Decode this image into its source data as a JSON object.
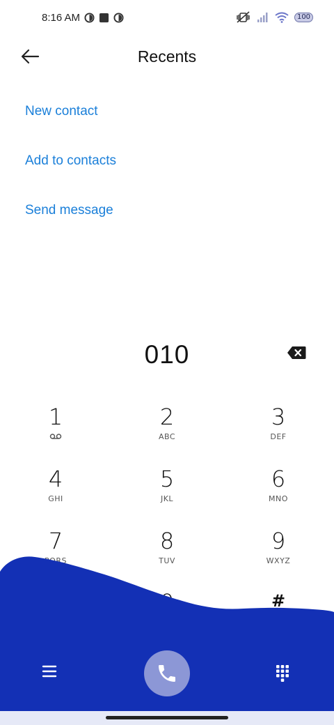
{
  "status_bar": {
    "time": "8:16 AM",
    "left_icons": [
      "data-saver-icon",
      "square-icon",
      "data-saver-icon"
    ],
    "right_icons": [
      "vibrate-silent-icon",
      "signal-icon",
      "wifi-icon"
    ],
    "battery": "100"
  },
  "header": {
    "title": "Recents",
    "back_icon": "arrow-left-icon"
  },
  "actions": {
    "new_contact": "New contact",
    "add_to_contacts": "Add to contacts",
    "send_message": "Send message"
  },
  "dialer": {
    "number": "010",
    "backspace_icon": "backspace-icon"
  },
  "keypad": {
    "keys": [
      {
        "digit": "1",
        "letters": ""
      },
      {
        "digit": "2",
        "letters": "ABC"
      },
      {
        "digit": "3",
        "letters": "DEF"
      },
      {
        "digit": "4",
        "letters": "GHI"
      },
      {
        "digit": "5",
        "letters": "JKL"
      },
      {
        "digit": "6",
        "letters": "MNO"
      },
      {
        "digit": "7",
        "letters": "PQRS"
      },
      {
        "digit": "8",
        "letters": "TUV"
      },
      {
        "digit": "9",
        "letters": "WXYZ"
      },
      {
        "digit": "*",
        "letters": ","
      },
      {
        "digit": "0",
        "letters": "+"
      },
      {
        "digit": "#",
        "letters": ""
      }
    ],
    "voicemail_icon": "voicemail-icon"
  },
  "bottom": {
    "menu_icon": "menu-icon",
    "call_icon": "phone-icon",
    "dialpad_icon": "dialpad-icon"
  },
  "colors": {
    "accent": "#1a7fd9",
    "wave": "#1330b5",
    "call_button": "#8c97d6"
  }
}
